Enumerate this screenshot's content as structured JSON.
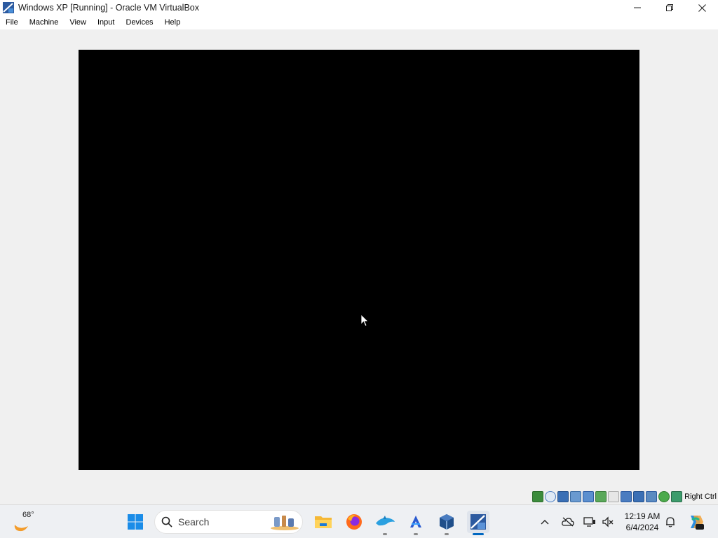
{
  "window": {
    "title": "Windows XP [Running] - Oracle VM VirtualBox",
    "menu": [
      "File",
      "Machine",
      "View",
      "Input",
      "Devices",
      "Help"
    ]
  },
  "statusbar": {
    "host_key_label": "Right Ctrl",
    "icons": [
      "hard-disk-icon",
      "optical-drive-icon",
      "floppy-icon",
      "audio-icon",
      "network-icon",
      "usb-icon",
      "shared-folders-icon",
      "display-icon",
      "recording-icon",
      "virtualization-icon",
      "mouse-integration-icon",
      "keyboard-icon"
    ]
  },
  "taskbar": {
    "weather_temp": "68°",
    "search_placeholder": "Search",
    "pinned_apps": [
      "start-button",
      "file-explorer",
      "firefox",
      "dolphin-emulator",
      "arc-app",
      "virtualbox",
      "windows-xp-vm"
    ],
    "clock_time": "12:19 AM",
    "clock_date": "6/4/2024"
  },
  "colors": {
    "vm_screen": "#000000",
    "taskbar_bg": "#eef0f3",
    "accent": "#0067c0"
  }
}
